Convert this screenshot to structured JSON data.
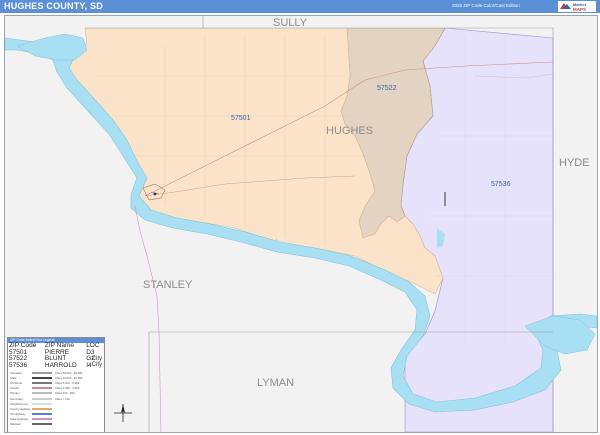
{
  "header": {
    "title": "HUGHES COUNTY, SD",
    "edition": "2025 ZIP Code Color/Cast Edition",
    "logo_text": "Market MAPS"
  },
  "map": {
    "county_labels": {
      "sully": "SULLY",
      "hughes": "HUGHES",
      "hyde": "HYDE",
      "stanley": "STANLEY",
      "lyman": "LYMAN"
    },
    "zip_labels": {
      "z57501": "57501",
      "z57522": "57522",
      "z57536": "57536"
    },
    "colors": {
      "zip_57501": "#fbe3c9",
      "zip_57522": "#e2d3c2",
      "zip_57536": "#e7e2fb",
      "water": "#a9dff2",
      "outside": "#f2f2f2"
    }
  },
  "legend": {
    "title": "ZIP Code Index/Grid Legend",
    "columns": [
      "ZIP Code",
      "ZIP Name",
      "LOC"
    ],
    "rows": [
      [
        "57501",
        "PIERRE",
        "D3"
      ],
      [
        "57522",
        "BLUNT",
        "G2"
      ],
      [
        "57536",
        "HARROLD",
        "I4"
      ]
    ],
    "city_title": "City",
    "city_sub": "City",
    "keys": [
      {
        "name": "Interstate",
        "desc": "Cities 50,000 - 99,999",
        "color": "#9b9b9b"
      },
      {
        "name": "State",
        "desc": "Cities 10,000 - 49,999",
        "color": "#444444"
      },
      {
        "name": "US Route",
        "desc": "Cities 5,000 - 9,999",
        "color": "#777777"
      },
      {
        "name": "Arterial",
        "desc": "Cities 1,000 - 4,999",
        "color": "#d08a8a"
      },
      {
        "name": "Primary",
        "desc": "Cities 100 - 999",
        "color": "#bbbbbb"
      },
      {
        "name": "Secondary",
        "desc": "Cities < 100",
        "color": "#cccccc"
      },
      {
        "name": "Neighborhood",
        "desc": "",
        "color": "#dddddd"
      },
      {
        "name": "County Highway",
        "desc": "",
        "color": "#e7a95e"
      },
      {
        "name": "US Highway",
        "desc": "",
        "color": "#5a7fd1"
      },
      {
        "name": "State Highway",
        "desc": "",
        "color": "#d78fcb"
      },
      {
        "name": "Railroad",
        "desc": "",
        "color": "#666666"
      },
      {
        "name": "Boundary",
        "desc": "",
        "color": "#999999"
      }
    ],
    "scale": "Scale"
  }
}
